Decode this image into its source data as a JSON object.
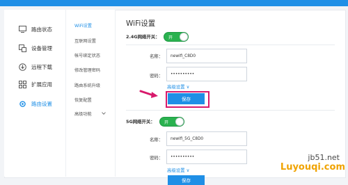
{
  "nav": {
    "items": [
      {
        "label": "路由状态",
        "icon": "monitor-icon"
      },
      {
        "label": "设备管理",
        "icon": "device-icon"
      },
      {
        "label": "远程下载",
        "icon": "download-icon"
      },
      {
        "label": "扩展应用",
        "icon": "apps-icon"
      },
      {
        "label": "路由设置",
        "icon": "gear-icon"
      }
    ]
  },
  "subnav": {
    "items": [
      {
        "label": "WiFi设置"
      },
      {
        "label": "互联网设置"
      },
      {
        "label": "帐号绑定状态"
      },
      {
        "label": "修改管理密码"
      },
      {
        "label": "路由系统升级"
      },
      {
        "label": "恢复配置"
      },
      {
        "label": "高级功能"
      }
    ]
  },
  "page": {
    "title": "WiFi设置"
  },
  "band24": {
    "switch_label": "2.4G网络开关：",
    "toggle_text": "开",
    "name_label": "名称：",
    "name_value": "newifi_C8D0",
    "password_label": "密码：",
    "password_value": "••••••••••",
    "advanced_label": "高级设置 ∨",
    "save_label": "保存"
  },
  "band5": {
    "switch_label": "5G网络开关：",
    "toggle_text": "开",
    "name_label": "名称：",
    "name_value": "newifi_5G_C8D0",
    "password_label": "密码：",
    "password_value": "••••••••••",
    "advanced_label": "高级设置 ∨",
    "save_label": "保存"
  },
  "watermark": {
    "line1": "jb51.net",
    "line2": "Luyouqi.com"
  },
  "colors": {
    "accent": "#1f8fe6",
    "toggle_on": "#2ab24f",
    "highlight": "#d8196b"
  }
}
